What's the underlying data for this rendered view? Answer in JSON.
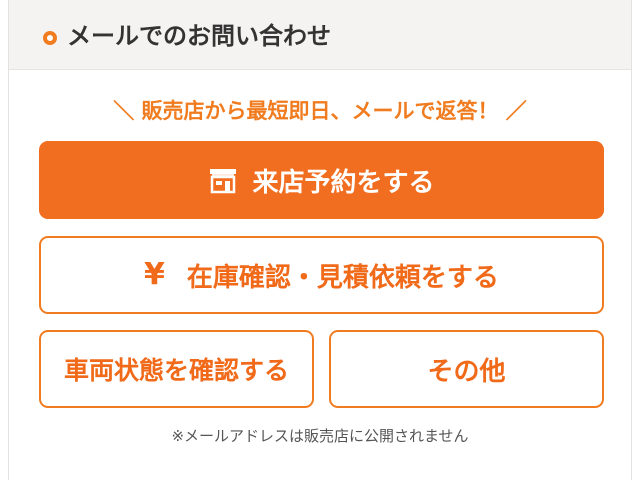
{
  "header": {
    "title": "メールでのお問い合わせ",
    "icon": "ring-bullet-icon"
  },
  "tagline": "＼ 販売店から最短即日、メールで返答！ ／",
  "buttons": {
    "reserve": {
      "label": "来店予約をする",
      "icon": "shop-icon"
    },
    "estimate": {
      "label": "在庫確認・見積依頼をする",
      "icon": "yen-icon",
      "icon_glyph": "¥"
    },
    "condition": {
      "label": "車両状態を確認する"
    },
    "other": {
      "label": "その他"
    }
  },
  "note": "※メールアドレスは販売店に公開されません",
  "colors": {
    "accent": "#f16d1f",
    "accent_text": "#f07c1f",
    "header_bg": "#f4f3f1",
    "text_dark": "#333333"
  }
}
